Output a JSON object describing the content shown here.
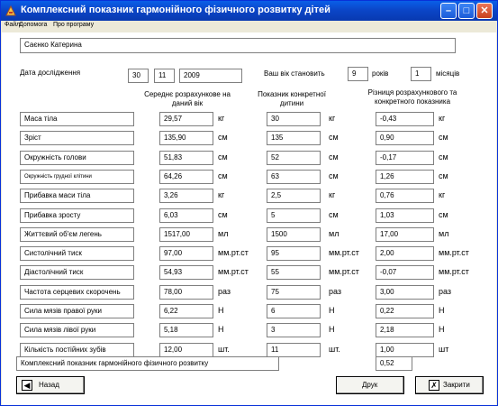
{
  "window": {
    "title": "Комплексний показник гармонійного фізичного розвитку дітей"
  },
  "menu": [
    "Файл",
    "Допомога",
    "Про програму"
  ],
  "header": {
    "name": "Саєнко Катерина",
    "date_label": "Дата дослідження",
    "day": "30",
    "month": "11",
    "year": "2009",
    "age_label": "Ваш вік становить",
    "years": "9",
    "years_unit": "років",
    "months": "1",
    "months_unit": "місяців"
  },
  "columns": {
    "average": "Середнє розрахункове на даний вік",
    "child": "Показник конкретної дитини",
    "diff": "Різниця розрахункового та конкретного показника"
  },
  "rows": [
    {
      "label": "Маса тіла",
      "avg": "29,57",
      "avg_unit": "кг",
      "child": "30",
      "child_unit": "кг",
      "diff": "-0,43",
      "diff_unit": "кг"
    },
    {
      "label": "Зріст",
      "avg": "135,90",
      "avg_unit": "см",
      "child": "135",
      "child_unit": "см",
      "diff": "0,90",
      "diff_unit": "см"
    },
    {
      "label": "Окружність голови",
      "avg": "51,83",
      "avg_unit": "см",
      "child": "52",
      "child_unit": "см",
      "diff": "-0,17",
      "diff_unit": "см"
    },
    {
      "label": "Окружність грудної клітини",
      "avg": "64,26",
      "avg_unit": "см",
      "child": "63",
      "child_unit": "см",
      "diff": "1,26",
      "diff_unit": "см"
    },
    {
      "label": "Прибавка маси тіла",
      "avg": "3,26",
      "avg_unit": "кг",
      "child": "2,5",
      "child_unit": "кг",
      "diff": "0,76",
      "diff_unit": "кг"
    },
    {
      "label": "Прибавка зросту",
      "avg": "6,03",
      "avg_unit": "см",
      "child": "5",
      "child_unit": "см",
      "diff": "1,03",
      "diff_unit": "см"
    },
    {
      "label": "Життєвий об'єм легень",
      "avg": "1517,00",
      "avg_unit": "мл",
      "child": "1500",
      "child_unit": "мл",
      "diff": "17,00",
      "diff_unit": "мл"
    },
    {
      "label": "Систолічний тиск",
      "avg": "97,00",
      "avg_unit": "мм.рт.ст",
      "child": "95",
      "child_unit": "мм.рт.ст",
      "diff": "2,00",
      "diff_unit": "мм.рт.ст"
    },
    {
      "label": "Діастолічний тиск",
      "avg": "54,93",
      "avg_unit": "мм.рт.ст",
      "child": "55",
      "child_unit": "мм.рт.ст",
      "diff": "-0,07",
      "diff_unit": "мм.рт.ст"
    },
    {
      "label": "Частота серцевих скорочень",
      "avg": "78,00",
      "avg_unit": "раз",
      "child": "75",
      "child_unit": "раз",
      "diff": "3,00",
      "diff_unit": "раз"
    },
    {
      "label": "Сила мязів правої руки",
      "avg": "6,22",
      "avg_unit": "Н",
      "child": "6",
      "child_unit": "Н",
      "diff": "0,22",
      "diff_unit": "Н"
    },
    {
      "label": "Сила мязів лівої руки",
      "avg": "5,18",
      "avg_unit": "Н",
      "child": "3",
      "child_unit": "Н",
      "diff": "2,18",
      "diff_unit": "Н"
    },
    {
      "label": "Кількість постійних зубів",
      "avg": "12,00",
      "avg_unit": "шт.",
      "child": "11",
      "child_unit": "шт.",
      "diff": "1,00",
      "diff_unit": "шт"
    }
  ],
  "summary": {
    "label": "Комплексний показник гармонійного фізичного розвитку",
    "value": "0,52"
  },
  "buttons": {
    "back": "Назад",
    "print": "Друк",
    "close": "Закрити"
  }
}
